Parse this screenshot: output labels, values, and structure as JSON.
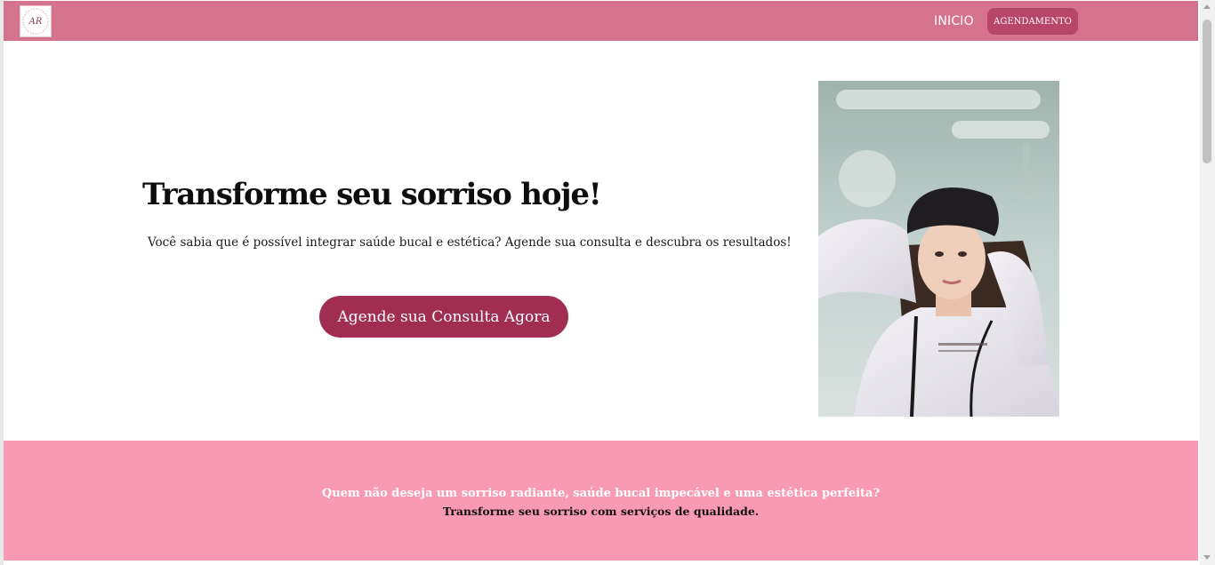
{
  "nav": {
    "logo_text": "AR",
    "inicio_label": "INICIO",
    "agendamento_label": "AGENDAMENTO"
  },
  "hero": {
    "title": "Transforme seu sorriso hoje!",
    "subtitle": "Você sabia que é possível integrar saúde bucal e estética? Agende sua consulta e descubra os resultados!",
    "cta_label": "Agende sua Consulta Agora"
  },
  "band": {
    "line1": "Quem não deseja um sorriso radiante, saúde bucal impecável e uma estética perfeita?",
    "line2": "Transforme seu sorriso com serviços de qualidade."
  },
  "colors": {
    "navbar": "#d5728e",
    "nav_button": "#b8456a",
    "cta": "#a12e52",
    "band": "#f99ab5"
  }
}
